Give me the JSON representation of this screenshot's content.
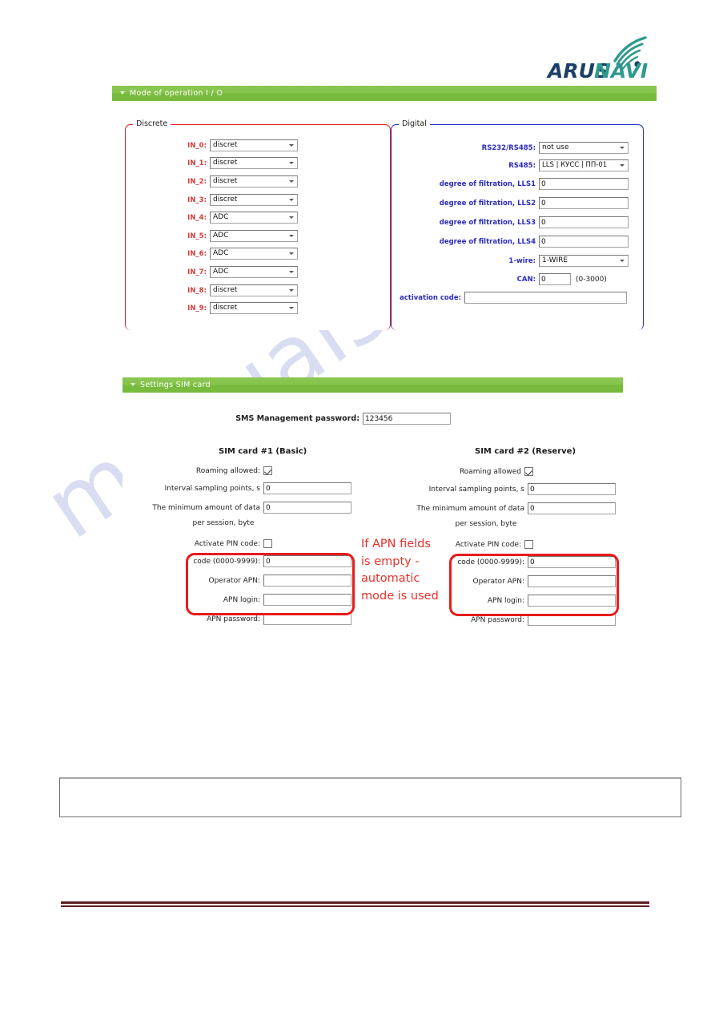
{
  "brand": {
    "name_part1": "ARUS",
    "name_part2": "NAVI",
    "color_dark": "#1d3f66",
    "color_teal": "#2e9a8f"
  },
  "watermark": {
    "text": "manualshive.com",
    "color": "#cfd4ef"
  },
  "panel_io": {
    "header_title": "Mode of operation I / O",
    "header_color": "#7fbf45",
    "discrete": {
      "legend": "Discrete",
      "border_color": "#e02020",
      "rows": [
        {
          "label": "IN_0:",
          "value": "discret"
        },
        {
          "label": "IN_1:",
          "value": "discret"
        },
        {
          "label": "IN_2:",
          "value": "discret"
        },
        {
          "label": "IN_3:",
          "value": "discret"
        },
        {
          "label": "IN_4:",
          "value": "ADC"
        },
        {
          "label": "IN_5:",
          "value": "ADC"
        },
        {
          "label": "IN_6:",
          "value": "ADC"
        },
        {
          "label": "IN_7:",
          "value": "ADC"
        },
        {
          "label": "IN_8:",
          "value": "discret"
        },
        {
          "label": "IN_9:",
          "value": "discret"
        }
      ]
    },
    "digital": {
      "legend": "Digital",
      "border_color": "#1f2fbe",
      "rows": [
        {
          "label": "RS232/RS485:",
          "value": "not use",
          "type": "select"
        },
        {
          "label": "RS485:",
          "value": "LLS | КУСС | ПП-01",
          "type": "select"
        },
        {
          "label": "degree of filtration, LLS1",
          "value": "0",
          "type": "text"
        },
        {
          "label": "degree of filtration, LLS2",
          "value": "0",
          "type": "text"
        },
        {
          "label": "degree of filtration, LLS3",
          "value": "0",
          "type": "text"
        },
        {
          "label": "degree of filtration, LLS4",
          "value": "0",
          "type": "text"
        },
        {
          "label": "1-wire:",
          "value": "1-WIRE",
          "type": "select"
        },
        {
          "label": "CAN:",
          "value": "0",
          "type": "text",
          "hint": "(0-3000)"
        },
        {
          "label": "activation code:",
          "value": "",
          "type": "text"
        }
      ]
    }
  },
  "panel_sim": {
    "header_title": "Settings SIM card",
    "header_color": "#7fbf45",
    "sms_password_label": "SMS Management password:",
    "sms_password_value": "123456",
    "card1": {
      "title": "SIM card #1 (Basic)",
      "roaming_label": "Roaming allowed:",
      "roaming_checked": true,
      "interval_label": "Interval sampling points, s",
      "interval_value": "0",
      "mindata_label": "The minimum amount of data",
      "mindata_label2": "per session, byte",
      "mindata_value": "0",
      "pin_label": "Activate PIN code:",
      "pin_checked": false,
      "code_label": "code (0000-9999):",
      "code_value": "0",
      "apn_label": "Operator APN:",
      "apn_value": "",
      "apn_login_label": "APN login:",
      "apn_login_value": "",
      "apn_password_label": "APN password:",
      "apn_password_value": ""
    },
    "card2": {
      "title": "SIM card #2 (Reserve)",
      "roaming_label": "Roaming allowed",
      "roaming_checked": true,
      "interval_label": "Interval sampling points, s",
      "interval_value": "0",
      "mindata_label": "The minimum amount of data",
      "mindata_label2": "per session, byte",
      "mindata_value": "0",
      "pin_label": "Activate PIN code:",
      "pin_checked": false,
      "code_label": "code (0000-9999):",
      "code_value": "0",
      "apn_label": "Operator APN:",
      "apn_value": "",
      "apn_login_label": "APN login:",
      "apn_login_value": "",
      "apn_password_label": "APN password:",
      "apn_password_value": ""
    }
  },
  "annotation": {
    "color": "#e8302b",
    "line1": "If APN fields",
    "line2": "is empty -",
    "line3": "automatic",
    "line4": "mode is used"
  },
  "note_box": {
    "text": ""
  }
}
